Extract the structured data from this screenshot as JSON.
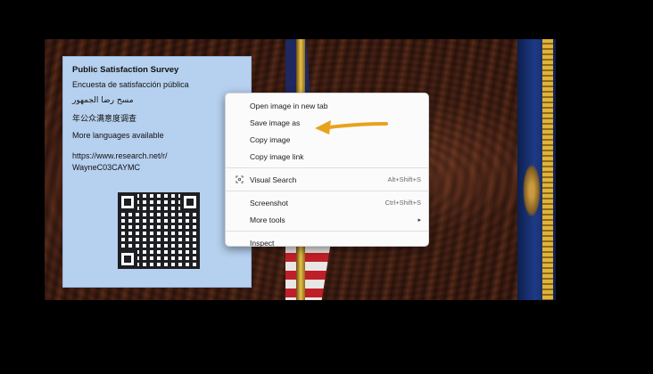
{
  "survey": {
    "title": "Public Satisfaction Survey",
    "spanish": "Encuesta de satisfacción pública",
    "arabic": "مسح رضا الجمهور",
    "chinese": "年公众满意度调查",
    "more_languages": "More languages available",
    "url_line1": "https://www.research.net/r/",
    "url_line2": "WayneC03CAYMC"
  },
  "context_menu": {
    "items": [
      {
        "label": "Open image in new tab"
      },
      {
        "label": "Save image as"
      },
      {
        "label": "Copy image"
      },
      {
        "label": "Copy image link"
      },
      {
        "label": "Visual Search",
        "shortcut": "Alt+Shift+S",
        "icon": "visual-search-icon"
      },
      {
        "label": "Screenshot",
        "shortcut": "Ctrl+Shift+S"
      },
      {
        "label": "More tools",
        "submenu": "▸"
      },
      {
        "label": "Inspect"
      }
    ]
  },
  "colors": {
    "annotation_arrow": "#e8a21c",
    "survey_card": "#b6d0ef",
    "menu_background": "#fbfbfb"
  }
}
